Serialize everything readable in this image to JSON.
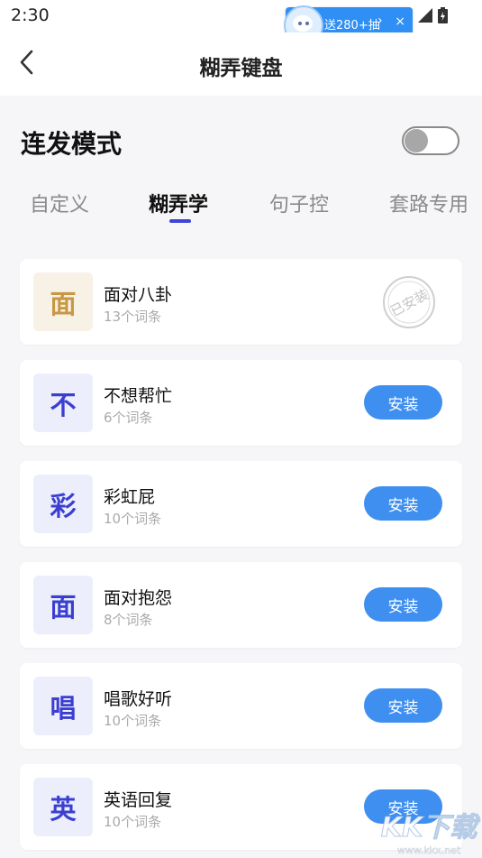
{
  "status_bar": {
    "time": "2:30"
  },
  "promo": {
    "text": "送280+抽",
    "arrow": "›",
    "close": "×"
  },
  "header": {
    "title": "糊弄键盘"
  },
  "mode": {
    "label": "连发模式",
    "enabled": false
  },
  "tabs": [
    {
      "label": "自定义",
      "active": false
    },
    {
      "label": "糊弄学",
      "active": true
    },
    {
      "label": "句子控",
      "active": false
    },
    {
      "label": "套路专用",
      "active": false
    }
  ],
  "items": [
    {
      "icon_char": "面",
      "title": "面对八卦",
      "count": "13个词条",
      "status": "installed",
      "action_label": "已安装"
    },
    {
      "icon_char": "不",
      "title": "不想帮忙",
      "count": "6个词条",
      "status": "install",
      "action_label": "安装"
    },
    {
      "icon_char": "彩",
      "title": "彩虹屁",
      "count": "10个词条",
      "status": "install",
      "action_label": "安装"
    },
    {
      "icon_char": "面",
      "title": "面对抱怨",
      "count": "8个词条",
      "status": "install",
      "action_label": "安装"
    },
    {
      "icon_char": "唱",
      "title": "唱歌好听",
      "count": "10个词条",
      "status": "install",
      "action_label": "安装"
    },
    {
      "icon_char": "英",
      "title": "英语回复",
      "count": "10个词条",
      "status": "install",
      "action_label": "安装"
    }
  ],
  "watermark": {
    "logo": "KK下载",
    "url": "www.kkx.net"
  },
  "colors": {
    "accent_blue": "#3e8ff0",
    "tab_indicator": "#3f44d6",
    "icon_bg_default": "#eceefc",
    "icon_fg_default": "#3b3fd0",
    "icon_bg_installed": "#f8f1e6",
    "icon_fg_installed": "#c89744"
  }
}
